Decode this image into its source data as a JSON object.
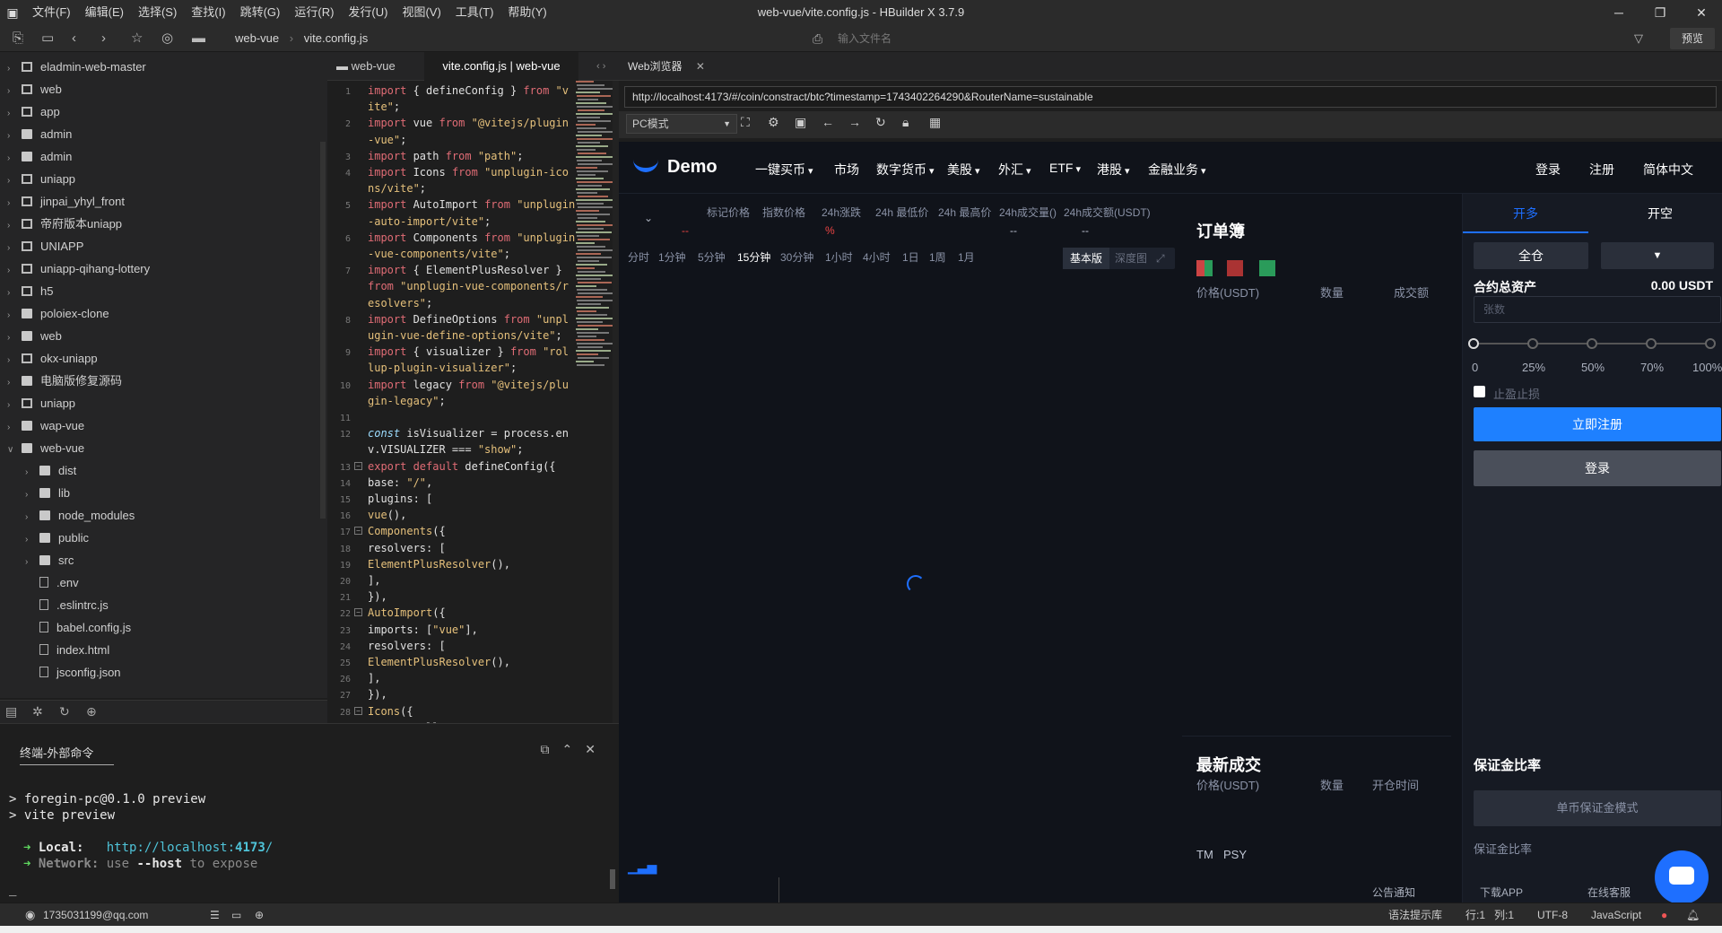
{
  "titlebar": {
    "title": "web-vue/vite.config.js - HBuilder X 3.7.9",
    "menu": [
      "文件(F)",
      "编辑(E)",
      "选择(S)",
      "查找(I)",
      "跳转(G)",
      "运行(R)",
      "发行(U)",
      "视图(V)",
      "工具(T)",
      "帮助(Y)"
    ]
  },
  "toolbar": {
    "breadcrumb": [
      "web-vue",
      "vite.config.js"
    ],
    "file_search_placeholder": "输入文件名",
    "preview_label": "预览"
  },
  "tree": {
    "items": [
      {
        "label": "eladmin-web-master",
        "type": "project"
      },
      {
        "label": "web",
        "type": "project"
      },
      {
        "label": "app",
        "type": "project"
      },
      {
        "label": "admin",
        "type": "folder"
      },
      {
        "label": "admin",
        "type": "folder"
      },
      {
        "label": "uniapp",
        "type": "project"
      },
      {
        "label": "jinpai_yhyl_front",
        "type": "project"
      },
      {
        "label": "帝府版本uniapp",
        "type": "project"
      },
      {
        "label": "UNIAPP",
        "type": "project"
      },
      {
        "label": "uniapp-qihang-lottery",
        "type": "project"
      },
      {
        "label": "h5",
        "type": "project"
      },
      {
        "label": "poloiex-clone",
        "type": "folder"
      },
      {
        "label": "web",
        "type": "folder"
      },
      {
        "label": "okx-uniapp",
        "type": "project"
      },
      {
        "label": "电脑版修复源码",
        "type": "folder"
      },
      {
        "label": "uniapp",
        "type": "project"
      },
      {
        "label": "wap-vue",
        "type": "folder"
      },
      {
        "label": "web-vue",
        "type": "folder",
        "open": true
      }
    ],
    "children": [
      {
        "label": "dist",
        "type": "folder"
      },
      {
        "label": "lib",
        "type": "folder"
      },
      {
        "label": "node_modules",
        "type": "folder"
      },
      {
        "label": "public",
        "type": "folder"
      },
      {
        "label": "src",
        "type": "folder"
      },
      {
        "label": ".env",
        "type": "file"
      },
      {
        "label": ".eslintrc.js",
        "type": "file"
      },
      {
        "label": "babel.config.js",
        "type": "file"
      },
      {
        "label": "index.html",
        "type": "file"
      },
      {
        "label": "jsconfig.json",
        "type": "file"
      }
    ]
  },
  "editor": {
    "tabs": [
      "web-vue",
      "vite.config.js | web-vue"
    ],
    "lines": [
      {
        "n": "1",
        "h": [
          [
            "kw",
            "import "
          ],
          [
            "id",
            "{ defineConfig } "
          ],
          [
            "kw",
            "from "
          ],
          [
            "st",
            "\"v"
          ]
        ]
      },
      {
        "n": "",
        "h": [
          [
            "st",
            "ite\""
          ],
          [
            "id",
            ";"
          ]
        ]
      },
      {
        "n": "2",
        "h": [
          [
            "kw",
            "import "
          ],
          [
            "id",
            "vue "
          ],
          [
            "kw",
            "from "
          ],
          [
            "st",
            "\"@vitejs/plugin"
          ]
        ]
      },
      {
        "n": "",
        "h": [
          [
            "st",
            "-vue\""
          ],
          [
            "id",
            ";"
          ]
        ]
      },
      {
        "n": "3",
        "h": [
          [
            "kw",
            "import "
          ],
          [
            "id",
            "path "
          ],
          [
            "kw",
            "from "
          ],
          [
            "st",
            "\"path\""
          ],
          [
            "id",
            ";"
          ]
        ]
      },
      {
        "n": "4",
        "h": [
          [
            "kw",
            "import "
          ],
          [
            "id",
            "Icons "
          ],
          [
            "kw",
            "from "
          ],
          [
            "st",
            "\"unplugin-ico"
          ]
        ]
      },
      {
        "n": "",
        "h": [
          [
            "st",
            "ns/vite\""
          ],
          [
            "id",
            ";"
          ]
        ]
      },
      {
        "n": "5",
        "h": [
          [
            "kw",
            "import "
          ],
          [
            "id",
            "AutoImport "
          ],
          [
            "kw",
            "from "
          ],
          [
            "st",
            "\"unplugin"
          ]
        ]
      },
      {
        "n": "",
        "h": [
          [
            "st",
            "-auto-import/vite\""
          ],
          [
            "id",
            ";"
          ]
        ]
      },
      {
        "n": "6",
        "h": [
          [
            "kw",
            "import "
          ],
          [
            "id",
            "Components "
          ],
          [
            "kw",
            "from "
          ],
          [
            "st",
            "\"unplugin"
          ]
        ]
      },
      {
        "n": "",
        "h": [
          [
            "st",
            "-vue-components/vite\""
          ],
          [
            "id",
            ";"
          ]
        ]
      },
      {
        "n": "7",
        "h": [
          [
            "kw",
            "import "
          ],
          [
            "id",
            "{ ElementPlusResolver }"
          ]
        ]
      },
      {
        "n": "",
        "h": [
          [
            "kw",
            "from "
          ],
          [
            "st",
            "\"unplugin-vue-components/r"
          ]
        ]
      },
      {
        "n": "",
        "h": [
          [
            "st",
            "esolvers\""
          ],
          [
            "id",
            ";"
          ]
        ]
      },
      {
        "n": "8",
        "h": [
          [
            "kw",
            "import "
          ],
          [
            "id",
            "DefineOptions "
          ],
          [
            "kw",
            "from "
          ],
          [
            "st",
            "\"unpl"
          ]
        ]
      },
      {
        "n": "",
        "h": [
          [
            "st",
            "ugin-vue-define-options/vite\""
          ],
          [
            "id",
            ";"
          ]
        ]
      },
      {
        "n": "9",
        "h": [
          [
            "kw",
            "import "
          ],
          [
            "id",
            "{ visualizer } "
          ],
          [
            "kw",
            "from "
          ],
          [
            "st",
            "\"rol"
          ]
        ]
      },
      {
        "n": "",
        "h": [
          [
            "st",
            "lup-plugin-visualizer\""
          ],
          [
            "id",
            ";"
          ]
        ]
      },
      {
        "n": "10",
        "h": [
          [
            "kw",
            "import "
          ],
          [
            "id",
            "legacy "
          ],
          [
            "kw",
            "from "
          ],
          [
            "st",
            "\"@vitejs/plu"
          ]
        ]
      },
      {
        "n": "",
        "h": [
          [
            "st",
            "gin-legacy\""
          ],
          [
            "id",
            ";"
          ]
        ]
      },
      {
        "n": "11",
        "h": []
      },
      {
        "n": "12",
        "h": [
          [
            "it",
            "const "
          ],
          [
            "id",
            "isVisualizer = process.en"
          ]
        ]
      },
      {
        "n": "",
        "h": [
          [
            "id",
            "v.VISUALIZER === "
          ],
          [
            "st",
            "\"show\""
          ],
          [
            "id",
            ";"
          ]
        ]
      },
      {
        "n": "13",
        "f": "−",
        "h": [
          [
            "kw",
            "export default "
          ],
          [
            "fn",
            "defineConfig({"
          ]
        ]
      },
      {
        "n": "14",
        "h": [
          [
            "id",
            "  base: "
          ],
          [
            "st",
            "\"/\""
          ],
          [
            "id",
            ","
          ]
        ]
      },
      {
        "n": "15",
        "h": [
          [
            "id",
            "  plugins: ["
          ]
        ]
      },
      {
        "n": "16",
        "h": [
          [
            "id",
            "    "
          ],
          [
            "st",
            "vue"
          ],
          [
            "id",
            "(),"
          ]
        ]
      },
      {
        "n": "17",
        "f": "−",
        "h": [
          [
            "id",
            "    "
          ],
          [
            "st",
            "Components"
          ],
          [
            "id",
            "({"
          ]
        ]
      },
      {
        "n": "18",
        "h": [
          [
            "id",
            "      resolvers: ["
          ]
        ]
      },
      {
        "n": "19",
        "h": [
          [
            "id",
            "        "
          ],
          [
            "st",
            "ElementPlusResolver"
          ],
          [
            "id",
            "(),"
          ]
        ]
      },
      {
        "n": "20",
        "h": [
          [
            "id",
            "      ],"
          ]
        ]
      },
      {
        "n": "21",
        "h": [
          [
            "id",
            "    }),"
          ]
        ]
      },
      {
        "n": "22",
        "f": "−",
        "h": [
          [
            "id",
            "    "
          ],
          [
            "st",
            "AutoImport"
          ],
          [
            "id",
            "({"
          ]
        ]
      },
      {
        "n": "23",
        "h": [
          [
            "id",
            "      imports: ["
          ],
          [
            "st",
            "\"vue\""
          ],
          [
            "id",
            "],"
          ]
        ]
      },
      {
        "n": "24",
        "h": [
          [
            "id",
            "      resolvers: ["
          ]
        ]
      },
      {
        "n": "25",
        "h": [
          [
            "id",
            "        "
          ],
          [
            "st",
            "ElementPlusResolver"
          ],
          [
            "id",
            "(),"
          ]
        ]
      },
      {
        "n": "26",
        "h": [
          [
            "id",
            "      ],"
          ]
        ]
      },
      {
        "n": "27",
        "h": [
          [
            "id",
            "    }),"
          ]
        ]
      },
      {
        "n": "28",
        "f": "−",
        "h": [
          [
            "id",
            "    "
          ],
          [
            "st",
            "Icons"
          ],
          [
            "id",
            "({"
          ]
        ]
      },
      {
        "n": "",
        "h": [
          [
            "id",
            "      autoInstall: "
          ],
          [
            "kw",
            "true"
          ],
          [
            "id",
            ","
          ]
        ]
      }
    ]
  },
  "terminal": {
    "tab_label": "终端-外部命令",
    "lines": [
      {
        "p": "> ",
        "t": "foregin-pc@0.1.0 preview"
      },
      {
        "p": "> ",
        "t": "vite preview"
      }
    ],
    "local_label": "Local:",
    "local_url_prefix": "http://localhost:",
    "local_port": "4173",
    "local_url_suffix": "/",
    "network_label": "Network:",
    "network_pre": "use",
    "network_flag": "--host",
    "network_post": "to expose",
    "cursor": "_"
  },
  "status": {
    "user": "1735031199@qq.com",
    "syntax_hint": "语法提示库",
    "row": "行:1",
    "col": "列:1",
    "encoding": "UTF-8",
    "language": "JavaScript"
  },
  "browser": {
    "tab_label": "Web浏览器",
    "url": "http://localhost:4173/#/coin/constract/btc?timestamp=1743402264290&RouterName=sustainable",
    "mode": "PC模式"
  },
  "web": {
    "brand": "Demo",
    "nav": [
      "一键买币",
      "市场",
      "数字货币",
      "美股",
      "外汇",
      "ETF",
      "港股",
      "金融业务"
    ],
    "nav_dropdown": [
      true,
      false,
      true,
      true,
      true,
      true,
      true,
      true
    ],
    "nav_right": [
      "登录",
      "注册",
      "简体中文"
    ],
    "info_headers": [
      "标记价格",
      "指数价格",
      "24h涨跌",
      "24h 最低价",
      "24h 最高价",
      "24h成交量()",
      "24h成交额(USDT)"
    ],
    "info_values": [
      "--",
      "%",
      "--",
      "--"
    ],
    "intervals": [
      "分时",
      "1分钟",
      "5分钟",
      "15分钟",
      "30分钟",
      "1小时",
      "4小时",
      "1日",
      "1周",
      "1月"
    ],
    "interval_active": "15分钟",
    "view_basic": "基本版",
    "view_depth": "深度图",
    "orderbook": {
      "title": "订单簿",
      "headers": [
        "价格(USDT)",
        "数量",
        "成交额"
      ]
    },
    "trades": {
      "title": "最新成交",
      "headers": [
        "价格(USDT)",
        "数量",
        "开仓时间"
      ],
      "tm": "TM",
      "psy": "PSY"
    },
    "order": {
      "tab_long": "开多",
      "tab_short": "开空",
      "margin_mode": "全仓",
      "asset_label": "合约总资产",
      "asset_value": "0.00 USDT",
      "qty_placeholder": "张数",
      "slider_marks": [
        "0",
        "25%",
        "50%",
        "70%",
        "100%"
      ],
      "tp_sl_label": "止盈止损",
      "register_btn": "立即注册",
      "login_btn": "登录",
      "margin_ratio_title": "保证金比率",
      "single_margin_mode": "单币保证金模式",
      "margin_ratio_label": "保证金比率"
    },
    "footer_links": [
      "公告通知",
      "下载APP",
      "在线客服"
    ]
  }
}
